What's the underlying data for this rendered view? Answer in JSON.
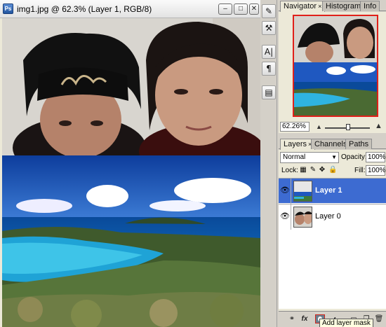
{
  "document": {
    "icon_label": "Ps",
    "title": "img1.jpg @ 62.3% (Layer 1, RGB/8)",
    "buttons": {
      "minimize": "–",
      "maximize": "□",
      "close": "✕"
    }
  },
  "tools": [
    {
      "name": "brush-preset-icon",
      "glyph": "✎"
    },
    {
      "name": "tool-preset-icon",
      "glyph": "⚒"
    },
    {
      "name": "character-icon",
      "glyph": "A|"
    },
    {
      "name": "paragraph-icon",
      "glyph": "¶"
    },
    {
      "name": "layer-comps-icon",
      "glyph": "▤"
    }
  ],
  "navigator_panel": {
    "tabs": [
      {
        "label": "Navigator",
        "close": "×",
        "active": true
      },
      {
        "label": "Histogram",
        "active": false
      },
      {
        "label": "Info",
        "active": false
      }
    ],
    "zoom": "62.26%"
  },
  "layers_panel": {
    "tabs": [
      {
        "label": "Layers",
        "close": "×",
        "active": true
      },
      {
        "label": "Channels",
        "active": false
      },
      {
        "label": "Paths",
        "active": false
      }
    ],
    "blend_mode": "Normal",
    "opacity_label": "Opacity:",
    "opacity_value": "100%",
    "lock_label": "Lock:",
    "fill_label": "Fill:",
    "fill_value": "100%",
    "layers": [
      {
        "name": "Layer 1",
        "selected": true,
        "visible": true
      },
      {
        "name": "Layer 0",
        "selected": false,
        "visible": true
      }
    ],
    "bottom_icons": [
      {
        "name": "link-layers-icon",
        "glyph": "⚭"
      },
      {
        "name": "layer-style-icon",
        "glyph": "fx"
      },
      {
        "name": "add-layer-mask-icon",
        "glyph": ""
      },
      {
        "name": "adjustment-layer-icon",
        "glyph": "◐"
      },
      {
        "name": "new-group-icon",
        "glyph": "▭"
      },
      {
        "name": "new-layer-icon",
        "glyph": "❐"
      },
      {
        "name": "delete-layer-icon",
        "glyph": "🗑"
      }
    ],
    "tooltip": "Add layer mask"
  },
  "colors": {
    "selection": "#3d6bd1",
    "navigator_view_box": "#e0201a",
    "tooltip_highlight": "#d0231b"
  }
}
